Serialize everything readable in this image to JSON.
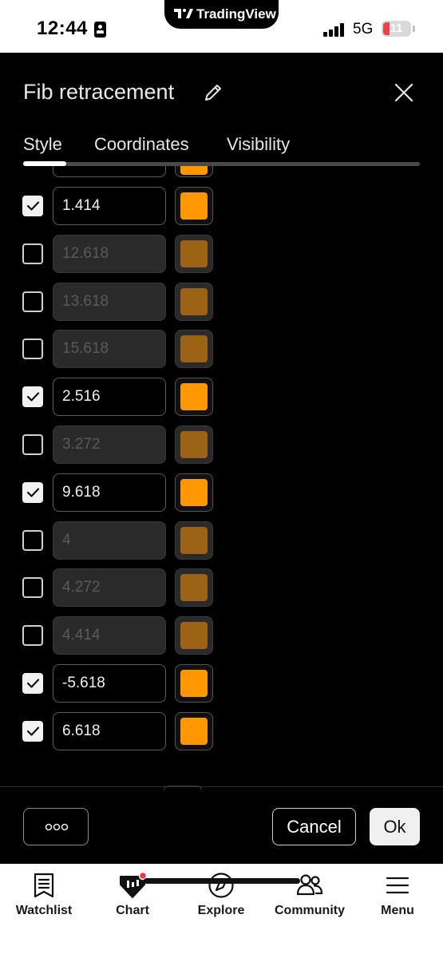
{
  "status_bar": {
    "time": "12:44",
    "network": "5G",
    "battery": "11",
    "app_name": "TradingView"
  },
  "dialog": {
    "title": "Fib retracement",
    "tabs": [
      {
        "label": "Style",
        "active": true
      },
      {
        "label": "Coordinates",
        "active": false
      },
      {
        "label": "Visibility",
        "active": false
      }
    ]
  },
  "levels": [
    {
      "value": "1.414",
      "checked": true,
      "color": "#FF9800"
    },
    {
      "value": "12.618",
      "checked": false,
      "color": "#9C6316"
    },
    {
      "value": "13.618",
      "checked": false,
      "color": "#9C6316"
    },
    {
      "value": "15.618",
      "checked": false,
      "color": "#9C6316"
    },
    {
      "value": "2.516",
      "checked": true,
      "color": "#FF9800"
    },
    {
      "value": "3.272",
      "checked": false,
      "color": "#9C6316"
    },
    {
      "value": "9.618",
      "checked": true,
      "color": "#FF9800"
    },
    {
      "value": "4",
      "checked": false,
      "color": "#9C6316"
    },
    {
      "value": "4.272",
      "checked": false,
      "color": "#9C6316"
    },
    {
      "value": "4.414",
      "checked": false,
      "color": "#9C6316"
    },
    {
      "value": "-5.618",
      "checked": true,
      "color": "#FF9800"
    },
    {
      "value": "6.618",
      "checked": true,
      "color": "#FF9800"
    }
  ],
  "footer": {
    "cancel_label": "Cancel",
    "ok_label": "Ok"
  },
  "bottom_nav": [
    {
      "label": "Watchlist",
      "icon": "bookmark-icon"
    },
    {
      "label": "Chart",
      "icon": "chart-icon"
    },
    {
      "label": "Explore",
      "icon": "compass-icon"
    },
    {
      "label": "Community",
      "icon": "people-icon"
    },
    {
      "label": "Menu",
      "icon": "menu-icon"
    }
  ],
  "colors": {
    "accent": "#FF9800",
    "accent_disabled": "#9C6316",
    "notification_dot": "#F23645"
  }
}
